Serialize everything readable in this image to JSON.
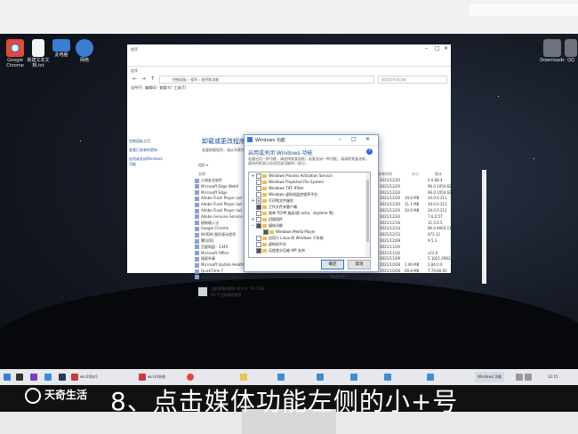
{
  "desktop": {
    "icons": [
      {
        "name": "google-chrome",
        "label": "Google Chrome",
        "color": "#e04a3b"
      },
      {
        "name": "new-text-doc",
        "label": "新建文本文档.txt",
        "color": "#f5f5f5"
      },
      {
        "name": "computer",
        "label": "此电脑",
        "color": "#3a7ed1"
      },
      {
        "name": "network",
        "label": "网络",
        "color": "#3a7ed1"
      }
    ],
    "right_icon_label": "Downloads",
    "right_icon2_label": "QQ"
  },
  "explorer": {
    "title": "程序",
    "breadcrumb": "控制面板 › 程序 › 程序和功能",
    "search_placeholder": "搜索程序和功能",
    "menu": [
      "文件(F)",
      "编辑(E)",
      "查看(V)",
      "工具(T)"
    ],
    "nav": [
      "控制面板主页",
      "查看已安装的更新",
      "启用或关闭Windows功能"
    ],
    "content_title": "卸载或更改程序",
    "content_sub": "若要卸载程序，请从列表中将其选中，然后单击\"卸载\"、\"更改\"或\"修复\"。",
    "organize": "组织 ▾",
    "columns": [
      "名称",
      "发布者",
      "安装时间",
      "大小",
      "版本"
    ],
    "rows": [
      {
        "name": "火绒安全软件",
        "date": "2021/12/20",
        "size": "",
        "ver": "5.0.68.4"
      },
      {
        "name": "Microsoft Edge WebV",
        "date": "2021/12/20",
        "size": "",
        "ver": "96.0.1054.62"
      },
      {
        "name": "Microsoft Edge",
        "date": "2021/12/20",
        "size": "",
        "ver": "96.0.1054.62"
      },
      {
        "name": "Adobe Flash Player (ad",
        "date": "2021/12/20",
        "size": "19.6 MB",
        "ver": "34.0.0.211"
      },
      {
        "name": "Adobe Flash Player (ad",
        "date": "2021/12/20",
        "size": "21.1 MB",
        "ver": "34.0.0.211"
      },
      {
        "name": "Adobe Flash Player (ad",
        "date": "2021/12/20",
        "size": "20.6 MB",
        "ver": "34.0.0.211"
      },
      {
        "name": "Adobe Genuine Service",
        "date": "2021/12/20",
        "size": "",
        "ver": "7.6.0.57"
      },
      {
        "name": "搜狗输入法",
        "date": "2021/12/16",
        "size": "",
        "ver": "11.5.0.5"
      },
      {
        "name": "Google Chrome",
        "date": "2021/12/14",
        "size": "",
        "ver": "96.0.4664.110"
      },
      {
        "name": "NVIDIA 图形驱动程序",
        "date": "2021/12/13",
        "size": "",
        "ver": "472.12"
      },
      {
        "name": "腾讯QQ",
        "date": "2021/12/08",
        "size": "",
        "ver": "9.5.3"
      },
      {
        "name": "百度网盘 - 2345",
        "date": "2021/11/30",
        "size": "",
        "ver": ""
      },
      {
        "name": "Microsoft Office",
        "date": "2021/11/30",
        "size": "",
        "ver": "v12.0"
      },
      {
        "name": "瑞星杀毒",
        "date": "2021/11/09",
        "size": "",
        "ver": "5.1021.2963.837"
      },
      {
        "name": "Microsoft Update Health Tools",
        "date": "2021/10/28",
        "size": "1.06 MB",
        "ver": "2.84.0.0"
      },
      {
        "name": "QuickTime 7",
        "date": "2021/10/28",
        "size": "69.8 MB",
        "ver": "7.79.80.95"
      },
      {
        "name": "Apple Software Update",
        "date": "2021/10/28",
        "size": "4.04 MB",
        "ver": "2.1.3.127"
      }
    ],
    "publishers": [
      "Apple Inc.",
      "Apple Inc."
    ],
    "status": {
      "line1": "当前安装的程序",
      "total": "总大小:",
      "size": "74.5 GB",
      "line2": "50 个已安装的程序"
    }
  },
  "dialog": {
    "title": "Windows 功能",
    "heading": "启用或关闭 Windows 功能",
    "description": "若要启用一种功能，请选择其复选框。若要关闭一种功能，请清除其复选框。填充的框表示仅启用该功能的一部分。",
    "features": [
      {
        "label": "Windows Process Activation Service",
        "state": "off",
        "expand": "+",
        "indent": 0
      },
      {
        "label": "Windows Projected File System",
        "state": "off",
        "expand": "",
        "indent": 0
      },
      {
        "label": "Windows TIFF IFilter",
        "state": "off",
        "expand": "",
        "indent": 0
      },
      {
        "label": "Windows 虚拟机监控程序平台",
        "state": "off",
        "expand": "",
        "indent": 0
      },
      {
        "label": "打印和文件服务",
        "state": "partial",
        "expand": "+",
        "indent": 0
      },
      {
        "label": "工作文件夹客户端",
        "state": "on",
        "expand": "",
        "indent": 0
      },
      {
        "label": "简单 TCPIP 服务(即 echo、daytime 等)",
        "state": "off",
        "expand": "",
        "indent": 0
      },
      {
        "label": "旧版组件",
        "state": "off",
        "expand": "+",
        "indent": 0
      },
      {
        "label": "媒体功能",
        "state": "on",
        "expand": "−",
        "indent": 0
      },
      {
        "label": "Windows Media Player",
        "state": "on",
        "expand": "",
        "indent": 1
      },
      {
        "label": "适用于 Linux 的 Windows 子系统",
        "state": "off",
        "expand": "",
        "indent": 0
      },
      {
        "label": "虚拟机平台",
        "state": "off",
        "expand": "",
        "indent": 0
      },
      {
        "label": "远程差分压缩 API 支持",
        "state": "on",
        "expand": "",
        "indent": 0
      }
    ],
    "ok_label": "确定",
    "cancel_label": "取消"
  },
  "taskbar": {
    "items": [
      "win10技巧",
      "win10系统",
      "",
      "Windows 功能"
    ],
    "time": "12:15"
  },
  "overlay": {
    "logo_text": "天奇生活",
    "caption": "8、点击媒体功能左侧的小+号"
  }
}
